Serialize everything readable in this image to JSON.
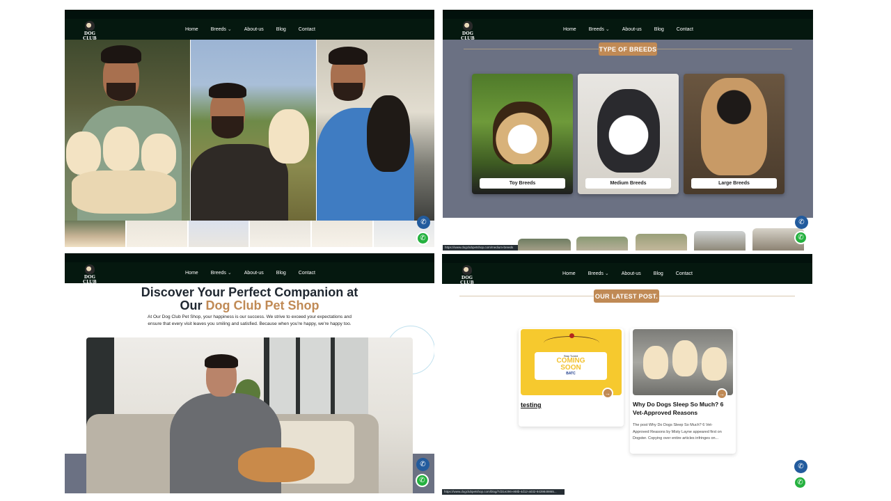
{
  "site": {
    "logo_text": "DOG CLUB",
    "nav": {
      "home": "Home",
      "breeds": "Breeds",
      "about": "About-us",
      "blog": "Blog",
      "contact": "Contact"
    }
  },
  "breeds_section": {
    "heading": "TYPE OF BREEDS",
    "cards": [
      {
        "label": "Toy Breeds"
      },
      {
        "label": "Medium Breeds"
      },
      {
        "label": "Large Breeds"
      }
    ],
    "status_url": "https://www.dogclubpetshop.com/medium-breeds"
  },
  "about_section": {
    "heading_line1": "Discover Your Perfect Companion at",
    "heading_our": "Our",
    "heading_brand": "Dog Club Pet Shop",
    "paragraph_line1": "At Our Dog Club Pet Shop, your happiness is our success. We strive to exceed your expectations and",
    "paragraph_line2": "ensure that every visit leaves you smiling and satisfied. Because when you're happy, we're happy too."
  },
  "blog_section": {
    "heading": "OUR LATEST POST.",
    "posts": [
      {
        "title": "testing",
        "image_small": "Stay Tuned",
        "image_big1": "COMING",
        "image_big2": "SOON",
        "image_brand": "BATC"
      },
      {
        "title_line1": "Why Do Dogs Sleep So Much? 6",
        "title_line2": "Vet-Approved Reasons",
        "excerpt_line1": "The post Why Do Dogs Sleep So Much? 6 Vet-",
        "excerpt_line2": "Approved Reasons by Misty Layne appeared first on",
        "excerpt_line3": "Dogster. Copying over entire articles infringes on..."
      }
    ],
    "status_url": "https://www.dogclubpetshop.com/blog/7d31e296-e88b-4d12-a032-9439849865..."
  },
  "icons": {
    "call": "phone-icon",
    "whatsapp": "whatsapp-icon",
    "arrow": "arrow-right-icon",
    "dropdown": "chevron-down-icon"
  },
  "colors": {
    "nav_bg": "#05180f",
    "accent": "#c08a55",
    "call_button": "#225b9d",
    "whatsapp_button": "#25b13f",
    "breeds_bg": "#6b7183"
  }
}
